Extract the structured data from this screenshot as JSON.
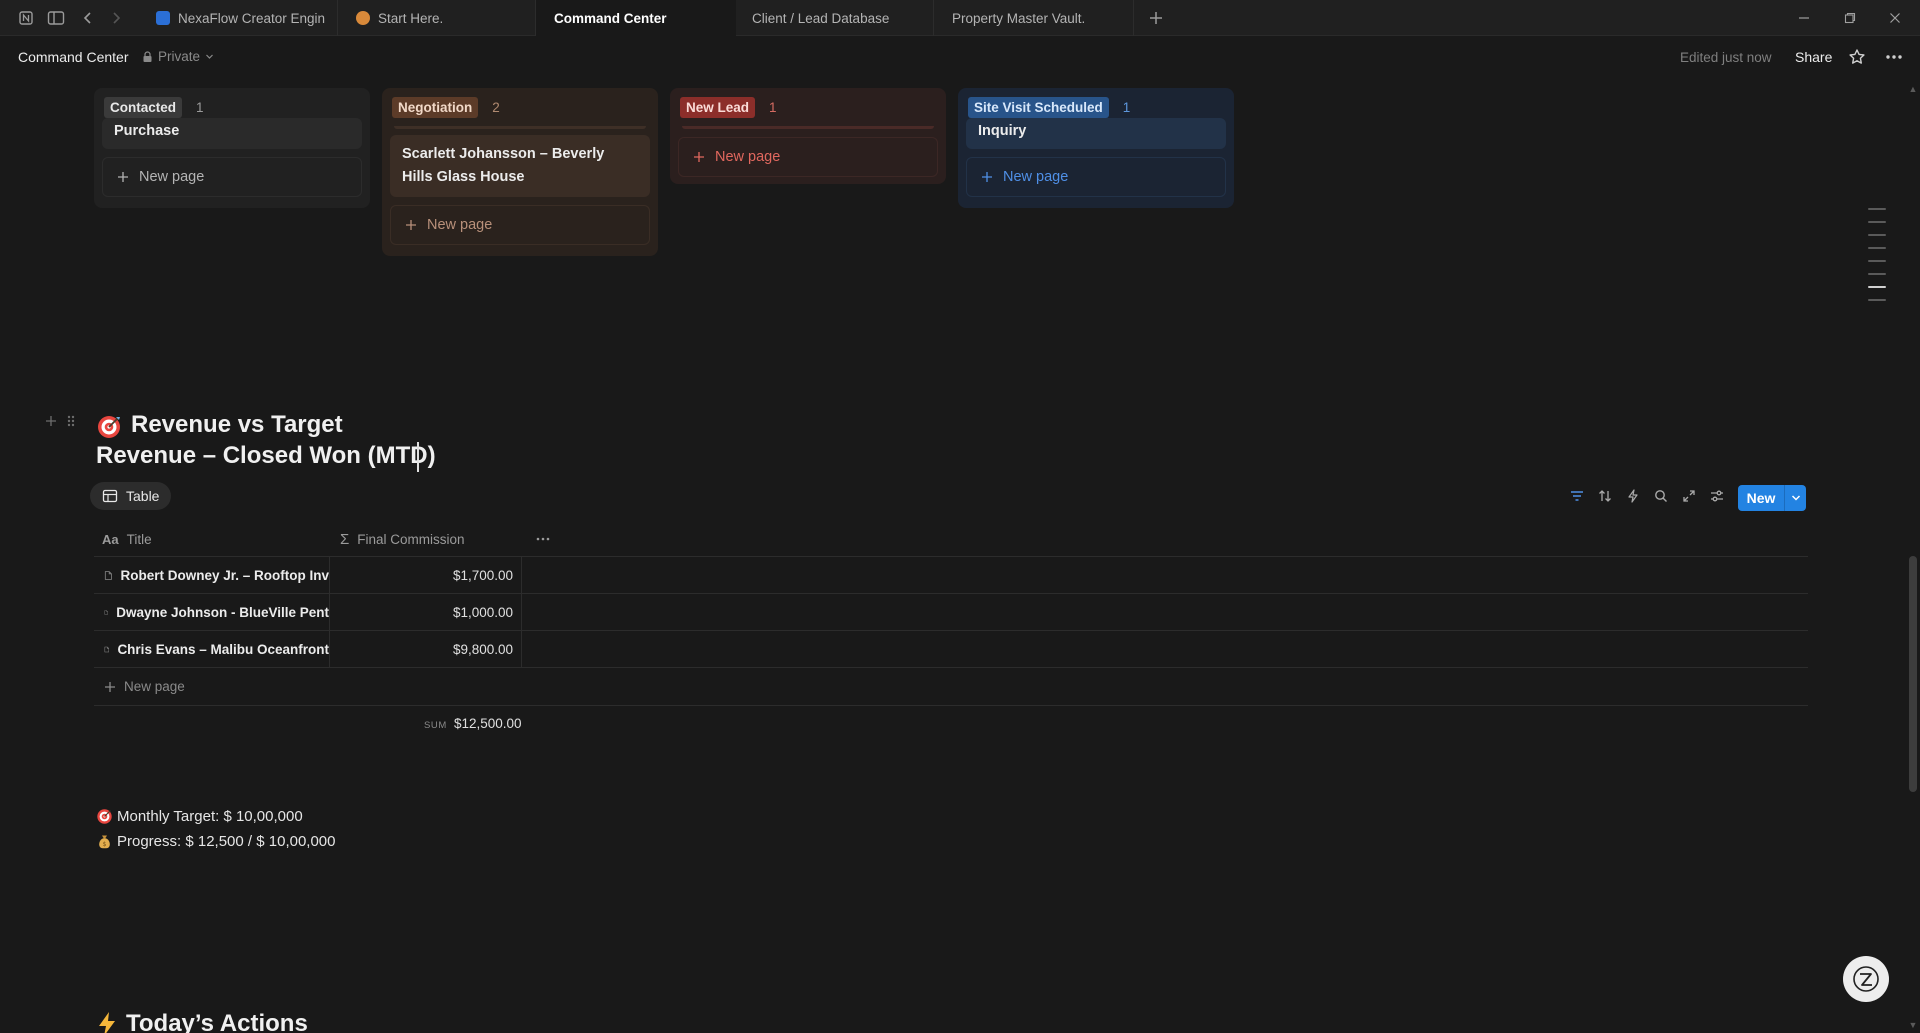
{
  "tabs": [
    {
      "label": "NexaFlow Creator Engin",
      "active": false
    },
    {
      "label": "Start Here.",
      "active": false
    },
    {
      "label": "Command Center",
      "active": true
    },
    {
      "label": "Client / Lead Database",
      "active": false
    },
    {
      "label": "Property Master Vault.",
      "active": false
    }
  ],
  "header": {
    "breadcrumb": "Command Center",
    "privacy": "Private",
    "edited": "Edited just now",
    "share": "Share"
  },
  "board": {
    "columns": [
      {
        "status": "Contacted",
        "count": "1",
        "card": "Purchase",
        "new_page": "New page"
      },
      {
        "status": "Negotiation",
        "count": "2",
        "card": "Scarlett Johansson – Beverly Hills Glass House",
        "new_page": "New page"
      },
      {
        "status": "New Lead",
        "count": "1",
        "card": "",
        "new_page": "New page"
      },
      {
        "status": "Site Visit Scheduled",
        "count": "1",
        "card": "Inquiry",
        "new_page": "New page"
      }
    ]
  },
  "section": {
    "title": "Revenue vs Target",
    "title_icon": "target-emoji",
    "subtitle": "Revenue – Closed Won (MTD)"
  },
  "database": {
    "view_label": "Table",
    "new_button": "New",
    "columns": [
      "Title",
      "Final Commission"
    ],
    "rows": [
      {
        "title": "Robert Downey Jr. – Rooftop Inv",
        "commission": "$1,700.00"
      },
      {
        "title": "Dwayne Johnson - BlueVille Pent",
        "commission": "$1,000.00"
      },
      {
        "title": "Chris Evans – Malibu Oceanfront",
        "commission": "$9,800.00"
      }
    ],
    "new_page": "New page",
    "sum_label": "SUM",
    "sum_value": "$12,500.00"
  },
  "target": {
    "monthly": "Monthly Target: $ 10,00,000",
    "progress": "Progress: $ 12,500 / $ 10,00,000"
  },
  "next_section": {
    "title": "Today’s Actions",
    "icon": "lightning-emoji"
  },
  "colors": {
    "accent": "#2383e2",
    "contacted": "#5a5a5a",
    "negotiation": "#8a5a3f",
    "new_lead": "#b3433b",
    "site_visit": "#2b5b9a"
  }
}
